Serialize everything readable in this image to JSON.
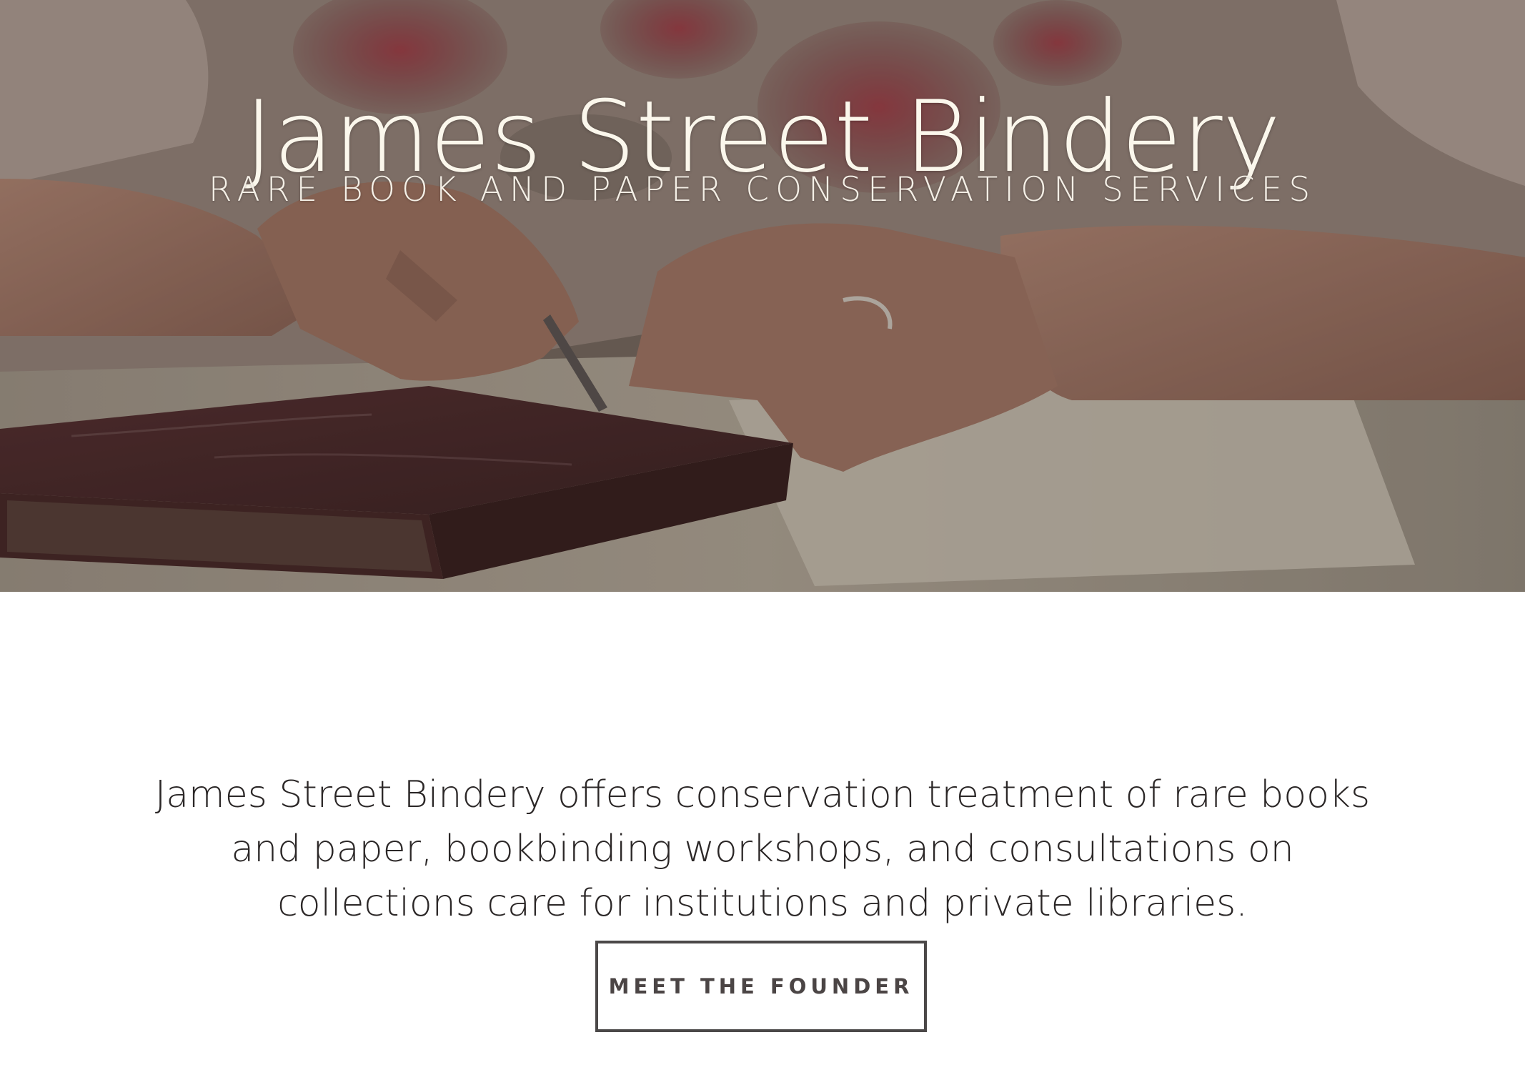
{
  "hero": {
    "title": "James Street Bindery",
    "subtitle": "RARE BOOK AND PAPER CONSERVATION SERVICES",
    "image": "hands-repairing-book-photo"
  },
  "intro": {
    "text": "James Street Bindery offers conservation treatment of rare books and paper, bookbinding workshops, and consultations on collections care for institutions and private libraries."
  },
  "cta": {
    "label": "MEET THE FOUNDER"
  },
  "colors": {
    "hero_text": "#fbf7ec",
    "body_text": "#2b2727",
    "button_border": "#4b4848",
    "background": "#ffffff"
  }
}
